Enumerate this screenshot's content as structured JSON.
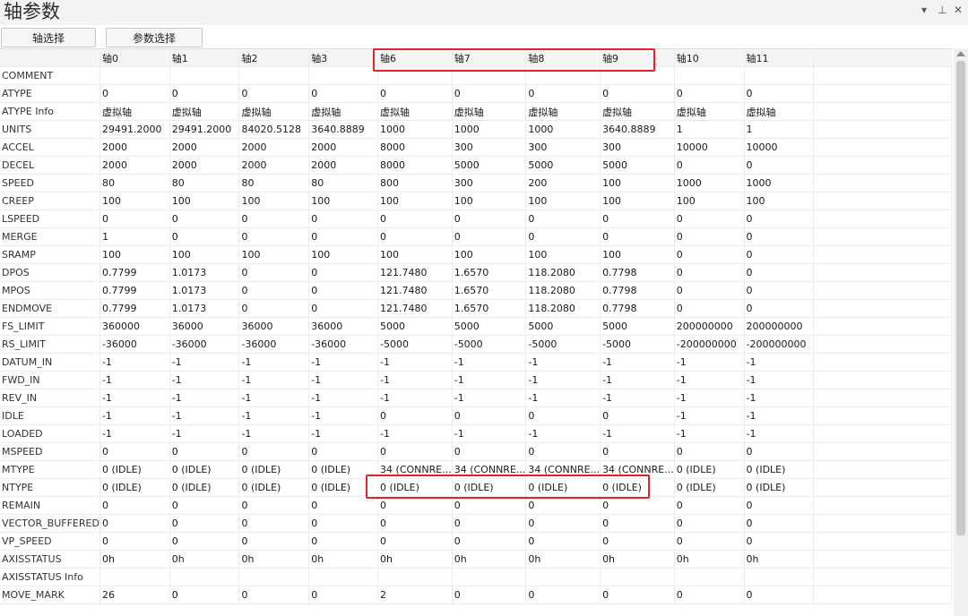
{
  "window": {
    "title": "轴参数",
    "controls": [
      "▾",
      "⊥",
      "✕"
    ]
  },
  "toolbar": {
    "axis_select_label": "轴选择",
    "param_select_label": "参数选择"
  },
  "grid": {
    "columns": [
      "",
      "轴0",
      "轴1",
      "轴2",
      "轴3",
      "轴6",
      "轴7",
      "轴8",
      "轴9",
      "轴10",
      "轴11",
      ""
    ],
    "rows": [
      [
        "COMMENT",
        "",
        "",
        "",
        "",
        "",
        "",
        "",
        "",
        "",
        "",
        ""
      ],
      [
        "ATYPE",
        "0",
        "0",
        "0",
        "0",
        "0",
        "0",
        "0",
        "0",
        "0",
        "0",
        ""
      ],
      [
        "ATYPE Info",
        "虚拟轴",
        "虚拟轴",
        "虚拟轴",
        "虚拟轴",
        "虚拟轴",
        "虚拟轴",
        "虚拟轴",
        "虚拟轴",
        "虚拟轴",
        "虚拟轴",
        ""
      ],
      [
        "UNITS",
        "29491.2000",
        "29491.2000",
        "84020.5128",
        "3640.8889",
        "1000",
        "1000",
        "1000",
        "3640.8889",
        "1",
        "1",
        ""
      ],
      [
        "ACCEL",
        "2000",
        "2000",
        "2000",
        "2000",
        "8000",
        "300",
        "300",
        "300",
        "10000",
        "10000",
        ""
      ],
      [
        "DECEL",
        "2000",
        "2000",
        "2000",
        "2000",
        "8000",
        "5000",
        "5000",
        "5000",
        "0",
        "0",
        ""
      ],
      [
        "SPEED",
        "80",
        "80",
        "80",
        "80",
        "800",
        "300",
        "200",
        "100",
        "1000",
        "1000",
        ""
      ],
      [
        "CREEP",
        "100",
        "100",
        "100",
        "100",
        "100",
        "100",
        "100",
        "100",
        "100",
        "100",
        ""
      ],
      [
        "LSPEED",
        "0",
        "0",
        "0",
        "0",
        "0",
        "0",
        "0",
        "0",
        "0",
        "0",
        ""
      ],
      [
        "MERGE",
        "1",
        "0",
        "0",
        "0",
        "0",
        "0",
        "0",
        "0",
        "0",
        "0",
        ""
      ],
      [
        "SRAMP",
        "100",
        "100",
        "100",
        "100",
        "100",
        "100",
        "100",
        "100",
        "0",
        "0",
        ""
      ],
      [
        "DPOS",
        "0.7799",
        "1.0173",
        "0",
        "0",
        "121.7480",
        "1.6570",
        "118.2080",
        "0.7798",
        "0",
        "0",
        ""
      ],
      [
        "MPOS",
        "0.7799",
        "1.0173",
        "0",
        "0",
        "121.7480",
        "1.6570",
        "118.2080",
        "0.7798",
        "0",
        "0",
        ""
      ],
      [
        "ENDMOVE",
        "0.7799",
        "1.0173",
        "0",
        "0",
        "121.7480",
        "1.6570",
        "118.2080",
        "0.7798",
        "0",
        "0",
        ""
      ],
      [
        "FS_LIMIT",
        "360000",
        "36000",
        "36000",
        "36000",
        "5000",
        "5000",
        "5000",
        "5000",
        "200000000",
        "200000000",
        ""
      ],
      [
        "RS_LIMIT",
        "-36000",
        "-36000",
        "-36000",
        "-36000",
        "-5000",
        "-5000",
        "-5000",
        "-5000",
        "-200000000",
        "-200000000",
        ""
      ],
      [
        "DATUM_IN",
        "-1",
        "-1",
        "-1",
        "-1",
        "-1",
        "-1",
        "-1",
        "-1",
        "-1",
        "-1",
        ""
      ],
      [
        "FWD_IN",
        "-1",
        "-1",
        "-1",
        "-1",
        "-1",
        "-1",
        "-1",
        "-1",
        "-1",
        "-1",
        ""
      ],
      [
        "REV_IN",
        "-1",
        "-1",
        "-1",
        "-1",
        "-1",
        "-1",
        "-1",
        "-1",
        "-1",
        "-1",
        ""
      ],
      [
        "IDLE",
        "-1",
        "-1",
        "-1",
        "-1",
        "0",
        "0",
        "0",
        "0",
        "-1",
        "-1",
        ""
      ],
      [
        "LOADED",
        "-1",
        "-1",
        "-1",
        "-1",
        "-1",
        "-1",
        "-1",
        "-1",
        "-1",
        "-1",
        ""
      ],
      [
        "MSPEED",
        "0",
        "0",
        "0",
        "0",
        "0",
        "0",
        "0",
        "0",
        "0",
        "0",
        ""
      ],
      [
        "MTYPE",
        "0 (IDLE)",
        "0 (IDLE)",
        "0 (IDLE)",
        "0 (IDLE)",
        "34 (CONNRE...",
        "34 (CONNRE...",
        "34 (CONNRE...",
        "34 (CONNRE...",
        "0 (IDLE)",
        "0 (IDLE)",
        ""
      ],
      [
        "NTYPE",
        "0 (IDLE)",
        "0 (IDLE)",
        "0 (IDLE)",
        "0 (IDLE)",
        "0 (IDLE)",
        "0 (IDLE)",
        "0 (IDLE)",
        "0 (IDLE)",
        "0 (IDLE)",
        "0 (IDLE)",
        ""
      ],
      [
        "REMAIN",
        "0",
        "0",
        "0",
        "0",
        "0",
        "0",
        "0",
        "0",
        "0",
        "0",
        ""
      ],
      [
        "VECTOR_BUFFERED",
        "0",
        "0",
        "0",
        "0",
        "0",
        "0",
        "0",
        "0",
        "0",
        "0",
        ""
      ],
      [
        "VP_SPEED",
        "0",
        "0",
        "0",
        "0",
        "0",
        "0",
        "0",
        "0",
        "0",
        "0",
        ""
      ],
      [
        "AXISSTATUS",
        "0h",
        "0h",
        "0h",
        "0h",
        "0h",
        "0h",
        "0h",
        "0h",
        "0h",
        "0h",
        ""
      ],
      [
        "AXISSTATUS Info",
        "",
        "",
        "",
        "",
        "",
        "",
        "",
        "",
        "",
        "",
        ""
      ],
      [
        "MOVE_MARK",
        "26",
        "0",
        "0",
        "0",
        "2",
        "0",
        "0",
        "0",
        "0",
        "0",
        ""
      ]
    ]
  },
  "annotation_color": "#e8202a"
}
